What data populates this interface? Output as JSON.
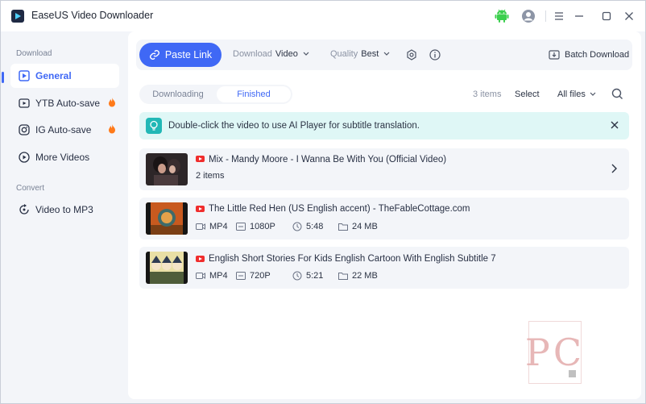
{
  "app": {
    "title": "EaseUS Video Downloader"
  },
  "titlebar": {
    "icons": [
      "android-icon",
      "account-icon",
      "menu-icon",
      "minimize-icon",
      "maximize-icon",
      "close-icon"
    ]
  },
  "sidebar": {
    "section_download": "Download",
    "section_convert": "Convert",
    "items": [
      {
        "label": "General",
        "icon": "general-icon",
        "active": true
      },
      {
        "label": "YTB Auto-save",
        "icon": "youtube-icon",
        "hot": true
      },
      {
        "label": "IG Auto-save",
        "icon": "instagram-icon",
        "hot": true
      },
      {
        "label": "More Videos",
        "icon": "play-circle-icon"
      },
      {
        "label": "Video to MP3",
        "icon": "convert-icon"
      }
    ]
  },
  "toolbar": {
    "paste_label": "Paste Link",
    "download_label": "Download",
    "download_value": "Video",
    "quality_label": "Quality",
    "quality_value": "Best",
    "batch_label": "Batch Download"
  },
  "tabs": {
    "downloading": "Downloading",
    "finished": "Finished"
  },
  "list": {
    "count": "3 items",
    "select": "Select",
    "filter": "All files"
  },
  "notice": {
    "text": "Double-click the video to use AI Player for subtitle translation."
  },
  "items": [
    {
      "title": "Mix - Mandy Moore - I Wanna Be With You (Official Video)",
      "subtitle": "2 items"
    },
    {
      "title": "The Little Red Hen (US English accent) - TheFableCottage.com",
      "format": "MP4",
      "resolution": "1080P",
      "duration": "5:48",
      "size": "24 MB"
    },
    {
      "title": "English Short Stories For Kids  English Cartoon With English Subtitle 7",
      "format": "MP4",
      "resolution": "720P",
      "duration": "5:21",
      "size": "22 MB"
    }
  ],
  "colors": {
    "accent": "#3f68f5",
    "notice_bg": "#dff7f6",
    "youtube_red": "#f02d2d"
  }
}
